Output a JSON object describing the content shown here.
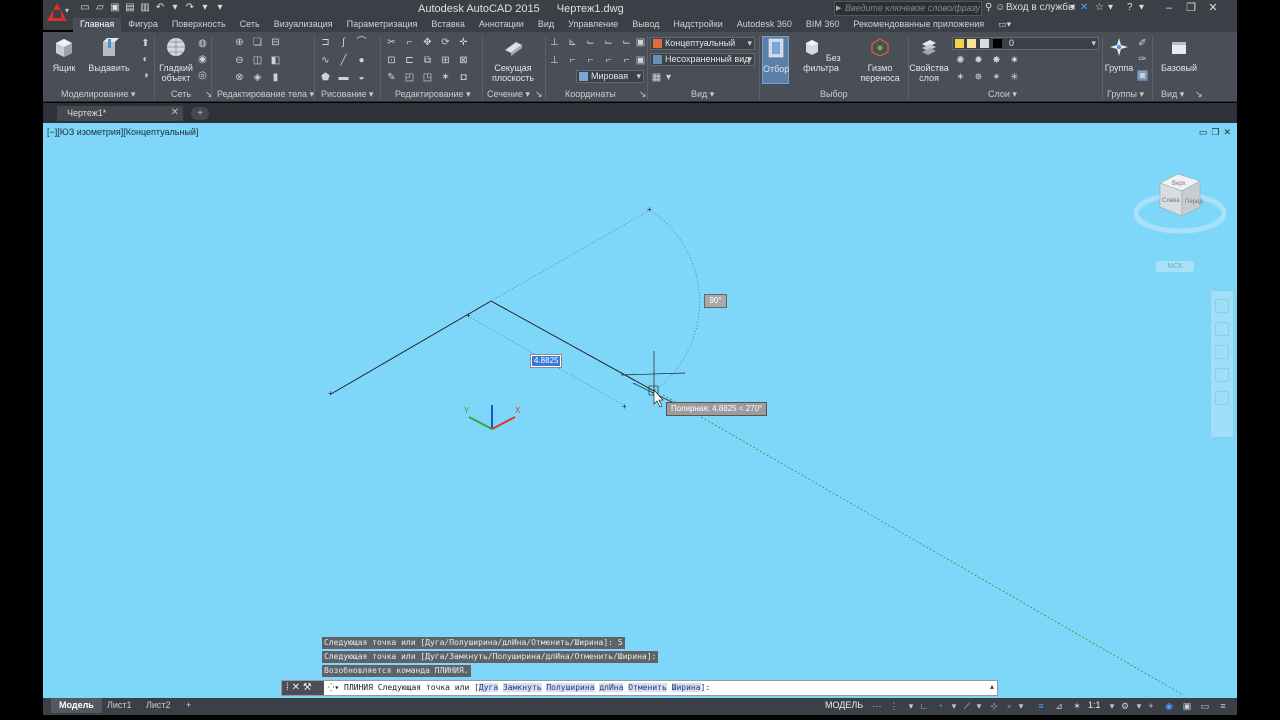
{
  "app": {
    "title": "Autodesk AutoCAD 2015",
    "filename": "Чертеж1.dwg",
    "search_placeholder": "Введите ключевое слово/фразу",
    "signin": "Вход в службы",
    "accent": "#d9302b"
  },
  "ribbon": {
    "tabs": [
      "Главная",
      "Фигура",
      "Поверхность",
      "Сеть",
      "Визуализация",
      "Параметризация",
      "Вставка",
      "Аннотации",
      "Вид",
      "Управление",
      "Вывод",
      "Надстройки",
      "Autodesk 360",
      "BIM 360",
      "Рекомендованные приложения"
    ],
    "active_tab": "Главная",
    "buttons": {
      "box": "Ящик",
      "extrude": "Выдавить",
      "smooth_object": "Гладкий объект",
      "section_plane": "Секущая плоскость",
      "select": "Отбор",
      "no_filter": "Без фильтра",
      "gizmo": "Гизмо переноса",
      "layer_props": "Свойства слоя",
      "group": "Группа",
      "base": "Базовый"
    },
    "combos": {
      "visual_style": "Концептуальный",
      "view": "Несохраненный вид",
      "coords": "Мировая",
      "layer": "0"
    },
    "panels": [
      "Моделирование",
      "Сеть",
      "Редактирование тела",
      "Рисование",
      "Редактирование",
      "Сечение",
      "Координаты",
      "Вид",
      "Выбор",
      "Слои",
      "Группы",
      "Вид"
    ]
  },
  "file_tab": {
    "name": "Чертеж1*"
  },
  "viewport": {
    "label": "[−][ЮЗ изометрия][Концептуальный]",
    "background": "#7ed6f9",
    "dim_input": "4.8825",
    "angle": "90°",
    "tooltip": "Полярная: 4.8825 < 270°",
    "viewcube": {
      "top": "Верх",
      "left": "Слева",
      "front": "Перед"
    },
    "wcs": "МСК"
  },
  "command": {
    "history": [
      "Следующая точка или [Дуга/Полуширина/длИна/Отменить/Ширина]: 5",
      "Следующая точка или [Дуга/Замкнуть/Полуширина/длИна/Отменить/Ширина]:",
      "Возобновляется команда ПЛИНИЯ."
    ],
    "prompt_prefix": "ПЛИНИЯ Следующая точка или [",
    "options": [
      "Дуга",
      "Замкнуть",
      "Полуширина",
      "длИна",
      "Отменить",
      "Ширина"
    ],
    "prompt_suffix": "]:"
  },
  "statusbar": {
    "layouts": [
      "Модель",
      "Лист1",
      "Лист2"
    ],
    "model": "МОДЕЛЬ",
    "scale": "1:1"
  }
}
